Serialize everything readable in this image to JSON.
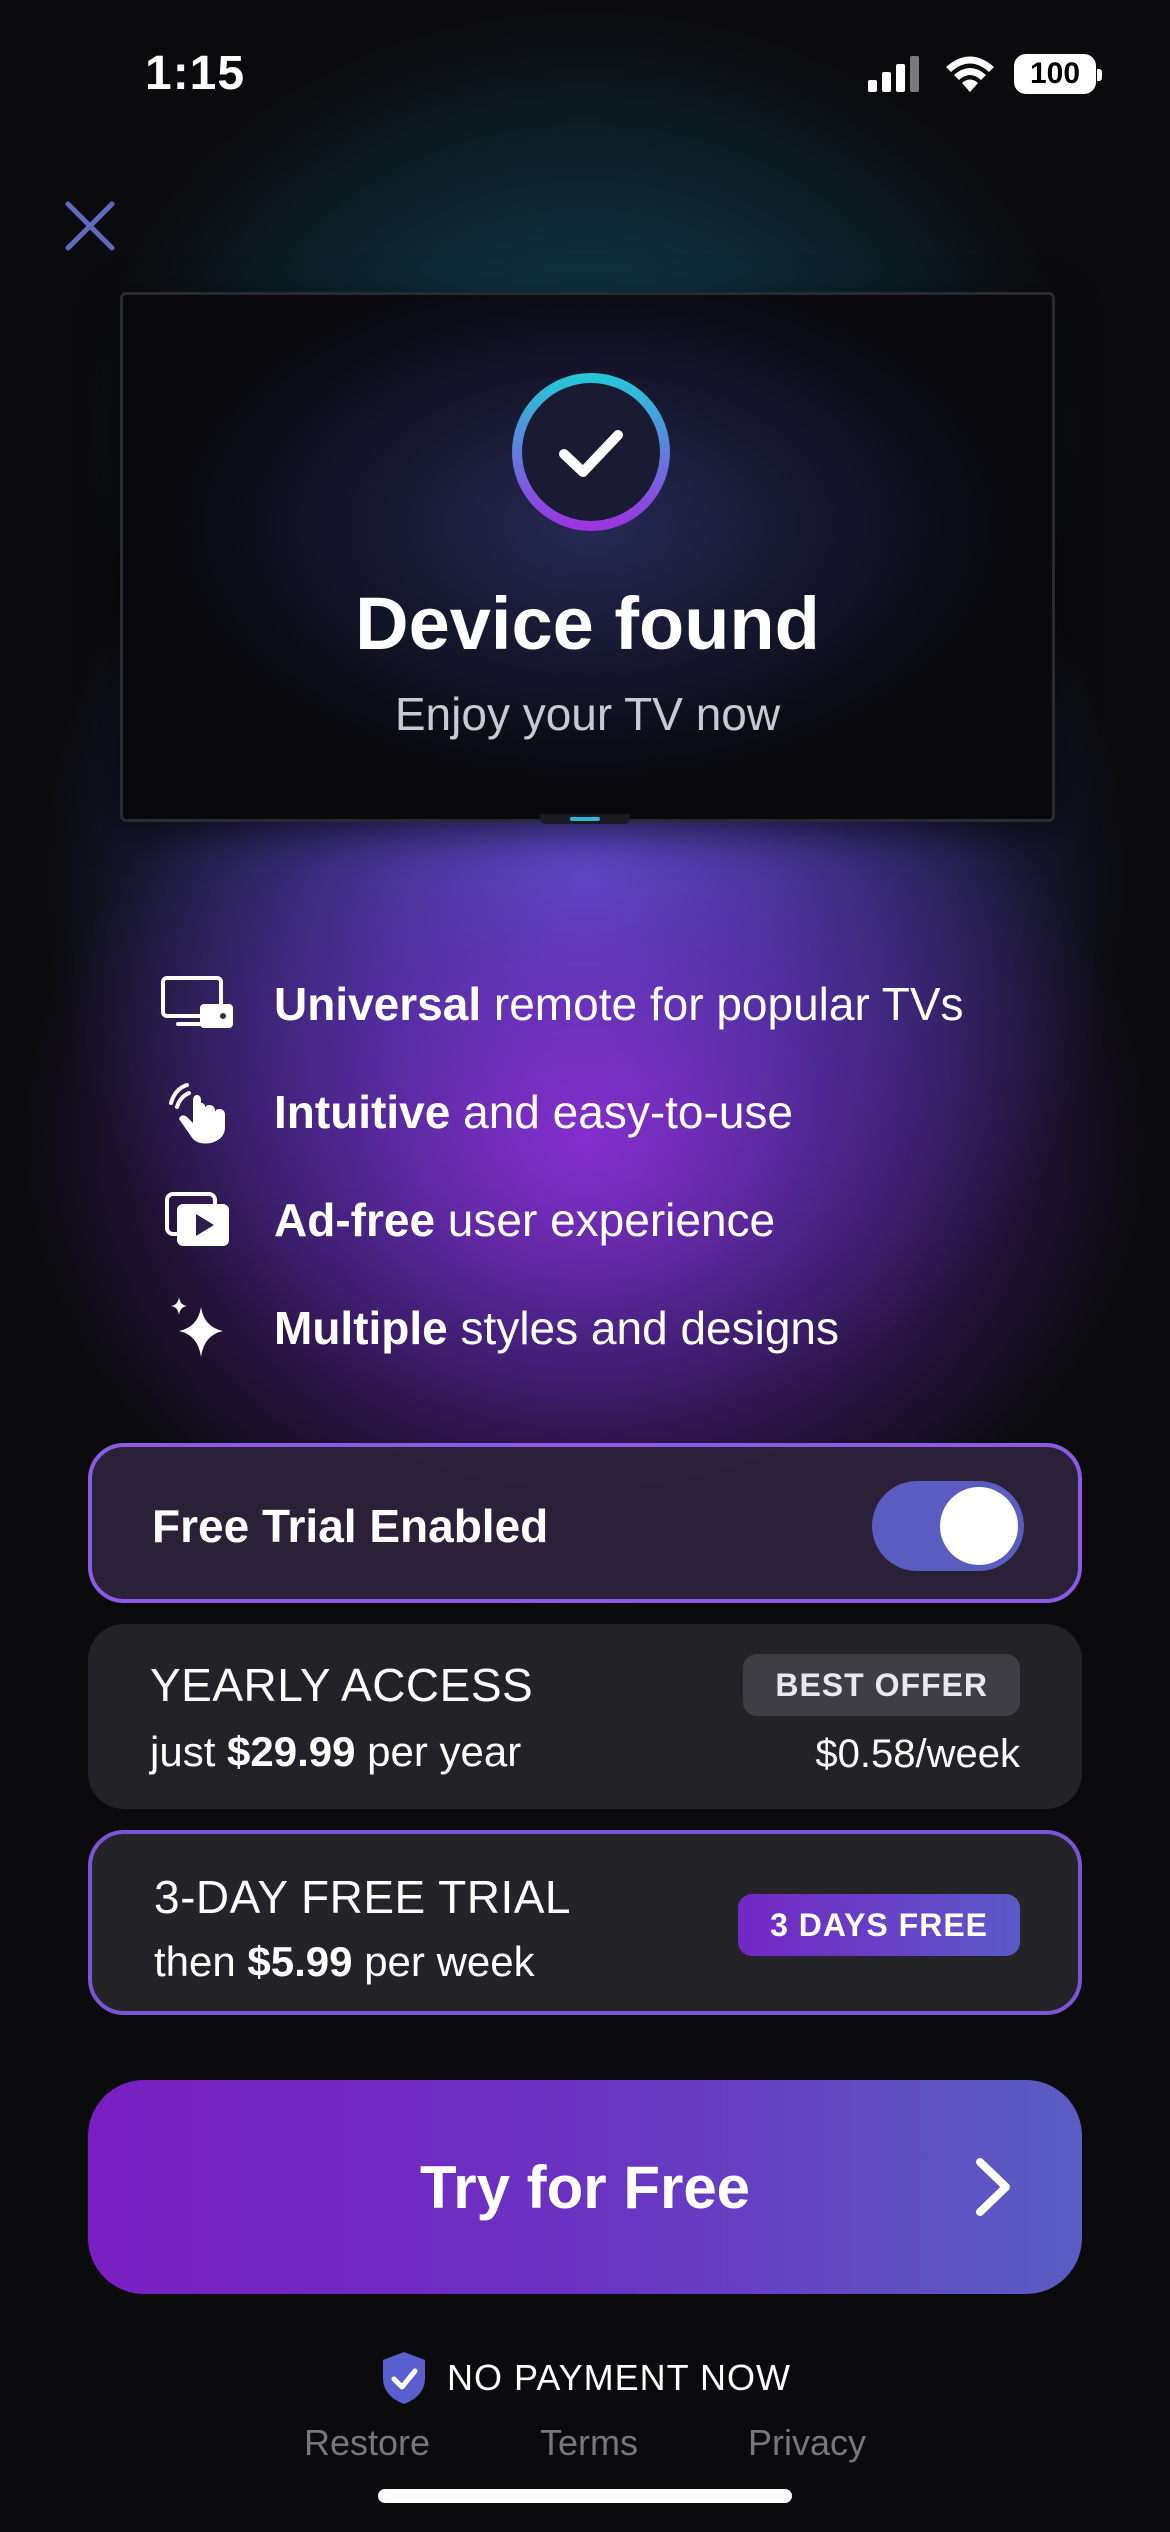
{
  "status_bar": {
    "time": "1:15",
    "battery": "100"
  },
  "tv": {
    "title": "Device found",
    "subtitle": "Enjoy your TV now"
  },
  "features": [
    {
      "bold": "Universal",
      "rest": " remote for popular TVs",
      "icon": "tv-remote-icon"
    },
    {
      "bold": "Intuitive",
      "rest": " and easy-to-use",
      "icon": "hand-tap-icon"
    },
    {
      "bold": "Ad-free",
      "rest": " user experience",
      "icon": "play-video-icon"
    },
    {
      "bold": "Multiple",
      "rest": " styles and designs",
      "icon": "sparkles-icon"
    }
  ],
  "free_trial_toggle": {
    "label": "Free Trial Enabled",
    "on": true
  },
  "plans": {
    "yearly": {
      "title": "YEARLY ACCESS",
      "price_prefix": "just ",
      "price": "$29.99",
      "price_suffix": " per year",
      "badge": "BEST OFFER",
      "per_week": "$0.58/week"
    },
    "weekly": {
      "title": "3-DAY FREE TRIAL",
      "price_prefix": "then ",
      "price": "$5.99",
      "price_suffix": " per week",
      "badge": "3 DAYS FREE"
    }
  },
  "cta": {
    "label": "Try for Free"
  },
  "no_payment": {
    "label": "NO PAYMENT NOW"
  },
  "footer": {
    "restore": "Restore",
    "terms": "Terms",
    "privacy": "Privacy"
  },
  "colors": {
    "accent_purple": "#7a1fc2",
    "accent_blue": "#5a5dc3",
    "toggle_on": "#5a5cbf",
    "ring_cyan": "#27c6d9"
  }
}
